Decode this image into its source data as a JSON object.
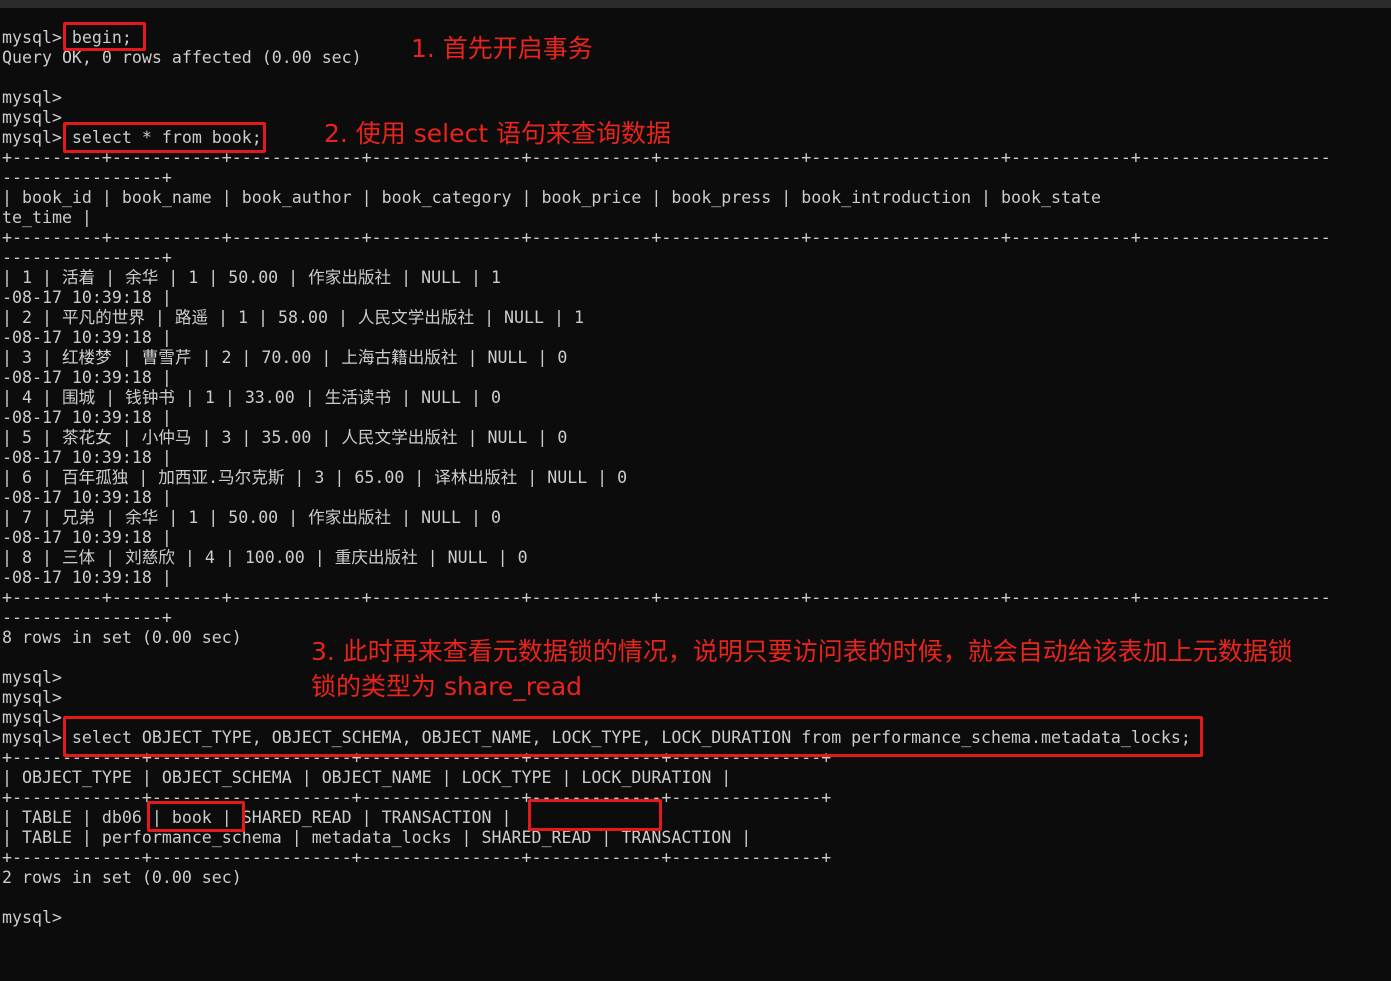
{
  "terminal_lines": [
    "mysql> begin;",
    "Query OK, 0 rows affected (0.00 sec)",
    "",
    "mysql>",
    "mysql>",
    "mysql> select * from book;",
    "+---------+-----------+-------------+---------------+------------+--------------+-------------------+------------+-------------------",
    "----------------+",
    "| book_id | book_name | book_author | book_category | book_price | book_press | book_introduction | book_state",
    "te_time |",
    "+---------+-----------+-------------+---------------+------------+--------------+-------------------+------------+-------------------",
    "----------------+",
    "| 1 | 活着 | 余华 | 1 | 50.00 | 作家出版社 | NULL | 1",
    "-08-17 10:39:18 |",
    "| 2 | 平凡的世界 | 路遥 | 1 | 58.00 | 人民文学出版社 | NULL | 1",
    "-08-17 10:39:18 |",
    "| 3 | 红楼梦 | 曹雪芹 | 2 | 70.00 | 上海古籍出版社 | NULL | 0",
    "-08-17 10:39:18 |",
    "| 4 | 围城 | 钱钟书 | 1 | 33.00 | 生活读书 | NULL | 0",
    "-08-17 10:39:18 |",
    "| 5 | 茶花女 | 小仲马 | 3 | 35.00 | 人民文学出版社 | NULL | 0",
    "-08-17 10:39:18 |",
    "| 6 | 百年孤独 | 加西亚.马尔克斯 | 3 | 65.00 | 译林出版社 | NULL | 0",
    "-08-17 10:39:18 |",
    "| 7 | 兄弟 | 余华 | 1 | 50.00 | 作家出版社 | NULL | 0",
    "-08-17 10:39:18 |",
    "| 8 | 三体 | 刘慈欣 | 4 | 100.00 | 重庆出版社 | NULL | 0",
    "-08-17 10:39:18 |",
    "+---------+-----------+-------------+---------------+------------+--------------+-------------------+------------+-------------------",
    "----------------+",
    "8 rows in set (0.00 sec)",
    "",
    "mysql>",
    "mysql>",
    "mysql>",
    "mysql> select OBJECT_TYPE, OBJECT_SCHEMA, OBJECT_NAME, LOCK_TYPE, LOCK_DURATION from performance_schema.metadata_locks;",
    "+-------------+--------------------+----------------+-------------+---------------+",
    "| OBJECT_TYPE | OBJECT_SCHEMA | OBJECT_NAME | LOCK_TYPE | LOCK_DURATION |",
    "+-------------+--------------------+----------------+-------------+---------------+",
    "| TABLE | db06 | book | SHARED_READ | TRANSACTION |",
    "| TABLE | performance_schema | metadata_locks | SHARED_READ | TRANSACTION |",
    "+-------------+--------------------+----------------+-------------+---------------+",
    "2 rows in set (0.00 sec)",
    "",
    "mysql>"
  ],
  "annotations": {
    "note1": "1. 首先开启事务",
    "note2": "2. 使用 select 语句来查询数据",
    "note3_line1": "3. 此时再来查看元数据锁的情况，说明只要访问表的时候，就会自动给该表加上元数据锁",
    "note3_line2": "锁的类型为 share_read"
  },
  "colors": {
    "background": "#0c0c0c",
    "text": "#cccccc",
    "annotation": "#e3191b"
  }
}
